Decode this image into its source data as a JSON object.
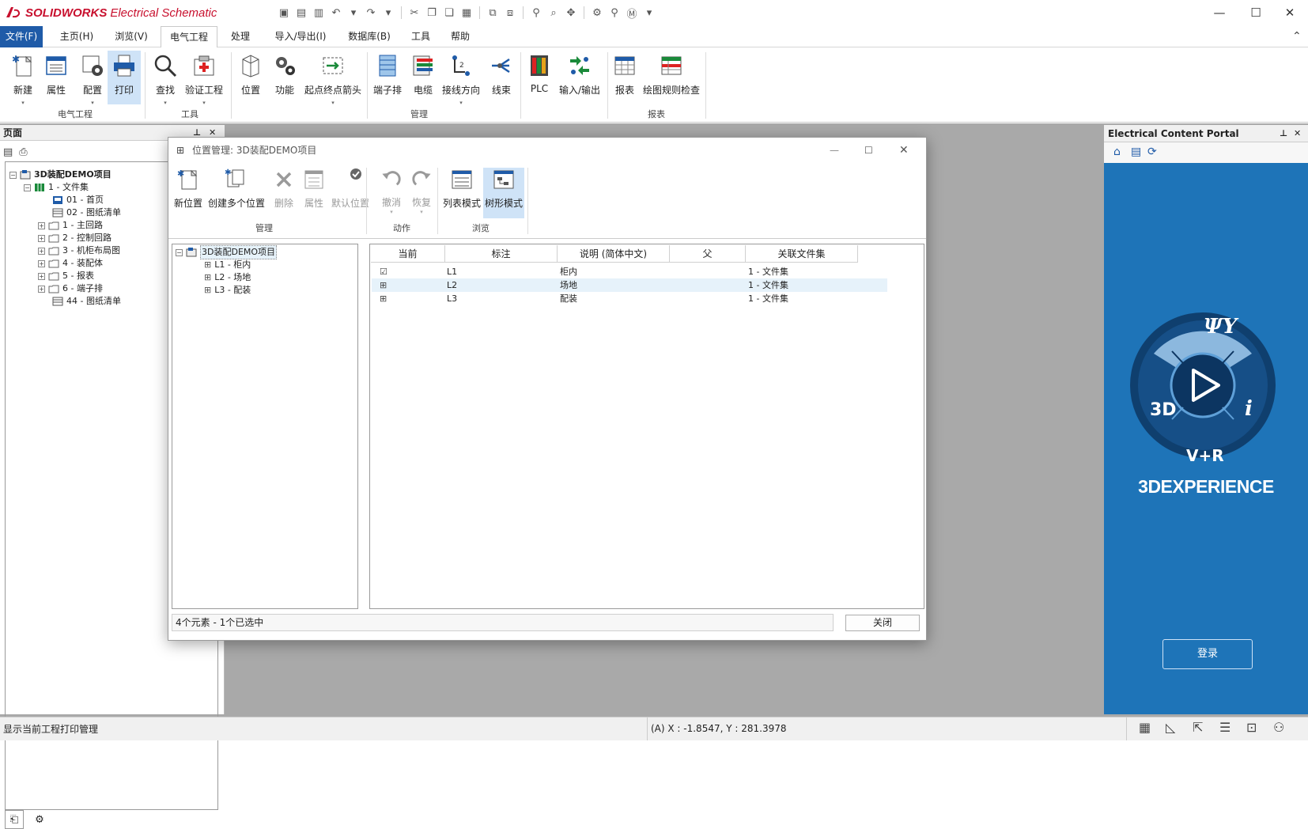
{
  "app": {
    "brand": "SOLIDWORKS",
    "subtitle": "Electrical Schematic"
  },
  "menu": [
    "文件(F)",
    "主页(H)",
    "浏览(V)",
    "电气工程",
    "处理",
    "导入/导出(I)",
    "数据库(B)",
    "工具",
    "帮助"
  ],
  "ribbon": {
    "buttons": [
      "新建",
      "属性",
      "配置",
      "打印",
      "查找",
      "验证工程",
      "位置",
      "功能",
      "起点终点箭头",
      "端子排",
      "电缆",
      "接线方向",
      "线束",
      "PLC",
      "输入/输出",
      "报表",
      "绘图规则检查"
    ],
    "groups": [
      "电气工程",
      "工具",
      "管理",
      "报表"
    ]
  },
  "left_panel": {
    "title": "页面",
    "tree": [
      {
        "label": "3D装配DEMO项目"
      },
      {
        "label": "1 - 文件集"
      },
      {
        "label": "01 - 首页"
      },
      {
        "label": "02 - 图纸清单"
      },
      {
        "label": "1 - 主回路"
      },
      {
        "label": "2 - 控制回路"
      },
      {
        "label": "3 - 机柜布局图"
      },
      {
        "label": "4 - 装配体"
      },
      {
        "label": "5 - 报表"
      },
      {
        "label": "6 - 端子排"
      },
      {
        "label": "44 - 图纸清单"
      }
    ]
  },
  "right_panel": {
    "title": "Electrical Content Portal",
    "logo_3d": "3D",
    "logo_vr": "V+R",
    "logo_i": "i",
    "brand": "3DEXPERIENCE",
    "login_button": "登录"
  },
  "dialog": {
    "title": "位置管理: 3D装配DEMO项目",
    "buttons": [
      "新位置",
      "创建多个位置",
      "删除",
      "属性",
      "默认位置",
      "撤消",
      "恢复",
      "列表模式",
      "树形模式"
    ],
    "groups": [
      "管理",
      "动作",
      "浏览"
    ],
    "tree": [
      "3D装配DEMO项目",
      "L1 - 柜内",
      "L2 - 场地",
      "L3 - 配装"
    ],
    "columns": [
      "当前",
      "标注",
      "说明 (简体中文)",
      "父",
      "关联文件集"
    ],
    "rows": [
      {
        "mark": "L1",
        "desc": "柜内",
        "parent": "",
        "fileset": "1 - 文件集"
      },
      {
        "mark": "L2",
        "desc": "场地",
        "parent": "",
        "fileset": "1 - 文件集"
      },
      {
        "mark": "L3",
        "desc": "配装",
        "parent": "",
        "fileset": "1 - 文件集"
      }
    ],
    "status": "4个元素 - 1个已选中",
    "close_button": "关闭"
  },
  "statusbar": {
    "hint": "显示当前工程打印管理",
    "coords": "(A) X : -1.8547, Y : 281.3978"
  },
  "colors": {
    "accent": "#1f5ba8",
    "brand_red": "#c8102e",
    "portal_blue": "#1e74b8",
    "selection": "#cfe3f7"
  }
}
